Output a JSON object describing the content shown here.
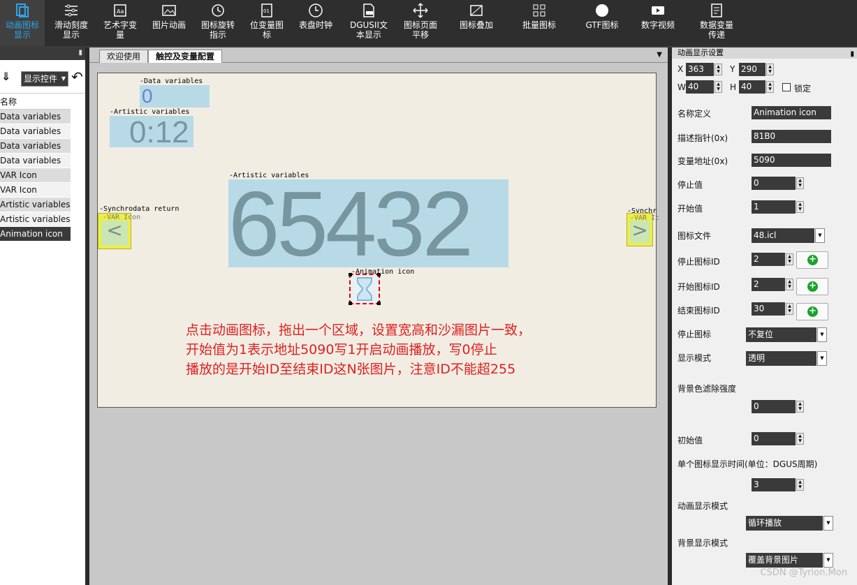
{
  "toolbar": {
    "items": [
      {
        "label": "动画图标\n显示",
        "icon": "animation-icon"
      },
      {
        "label": "滑动刻度\n显示",
        "icon": "sliders-icon"
      },
      {
        "label": "艺术字变\n量",
        "icon": "art-text-icon"
      },
      {
        "label": "图片动画",
        "icon": "picture-icon"
      },
      {
        "label": "图标旋转\n指示",
        "icon": "rotate-icon"
      },
      {
        "label": "位变量图\n标",
        "icon": "bit-var-icon"
      },
      {
        "label": "表盘时钟",
        "icon": "clock-icon"
      },
      {
        "label": "DGUSII文\n本显示",
        "icon": "text-icon"
      },
      {
        "label": "图标页面\n平移",
        "icon": "move-icon"
      },
      {
        "label": "图标叠加",
        "icon": "overlay-icon"
      },
      {
        "label": "批量图标",
        "icon": "batch-icon"
      },
      {
        "label": "GTF图标",
        "icon": "gtf-icon"
      },
      {
        "label": "数字视频",
        "icon": "video-icon"
      },
      {
        "label": "数据变量\n传递",
        "icon": "data-transfer-icon"
      }
    ]
  },
  "left_panel": {
    "dropdown_label": "显示控件",
    "header": "名称",
    "items": [
      "Data variables",
      "Data variables",
      "Data variables",
      "Data variables",
      "VAR Icon",
      "VAR Icon",
      "Artistic variables",
      "Artistic variables",
      "Animation icon"
    ]
  },
  "tabs": [
    {
      "label": "欢迎使用"
    },
    {
      "label": "触控及变量配置"
    }
  ],
  "canvas": {
    "widgets": {
      "data_var_label": "-Data variables",
      "data_var_value": "0",
      "art_var1_label": "-Artistic variables",
      "art_var1_value": "0:12",
      "art_var2_label": "-Artistic variables",
      "art_var2_value": "65432",
      "sync_label_left": "-Synchrodata return",
      "var_icon_label_left": "-VAR Icon",
      "sync_label_right": "-Synchr",
      "var_icon_label_right": "-VAR Ic",
      "anim_label": "-Animation icon",
      "left_arrow": "<",
      "right_arrow": ">"
    },
    "note_lines": [
      "点击动画图标，拖出一个区域，设置宽高和沙漏图片一致，",
      "开始值为1表示地址5090写1开启动画播放，写0停止",
      "播放的是开始ID至结束ID这N张图片，注意ID不能超255"
    ]
  },
  "props": {
    "title": "动画显示设置",
    "x_label": "X",
    "x_value": "363",
    "y_label": "Y",
    "y_value": "290",
    "w_label": "W",
    "w_value": "40",
    "h_label": "H",
    "h_value": "40",
    "lock_label": "锁定",
    "name_label": "名称定义",
    "name_value": "Animation icon",
    "desc_ptr_label": "描述指针(0x)",
    "desc_ptr_value": "81B0",
    "var_addr_label": "变量地址(0x)",
    "var_addr_value": "5090",
    "stop_val_label": "停止值",
    "stop_val_value": "0",
    "start_val_label": "开始值",
    "start_val_value": "1",
    "icon_file_label": "图标文件",
    "icon_file_value": "48.icl",
    "stop_icon_id_label": "停止图标ID",
    "stop_icon_id_value": "2",
    "start_icon_id_label": "开始图标ID",
    "start_icon_id_value": "2",
    "end_icon_id_label": "结束图标ID",
    "end_icon_id_value": "30",
    "stop_icon_label": "停止图标",
    "stop_icon_value": "不复位",
    "display_mode_label": "显示模式",
    "display_mode_value": "透明",
    "bg_filter_label": "背景色滤除强度",
    "bg_filter_value": "0",
    "init_val_label": "初始值",
    "init_val_value": "0",
    "single_time_label": "单个图标显示时间(单位：DGUS周期)",
    "single_time_value": "3",
    "anim_mode_label": "动画显示模式",
    "anim_mode_value": "循环播放",
    "bg_mode_label": "背景显示模式",
    "bg_mode_value": "覆盖背景图片"
  },
  "watermark": "CSDN @Tyrion.Mon",
  "colors": {
    "accent": "#31a5e6",
    "note": "#e02020",
    "add_green": "#19a42a"
  }
}
